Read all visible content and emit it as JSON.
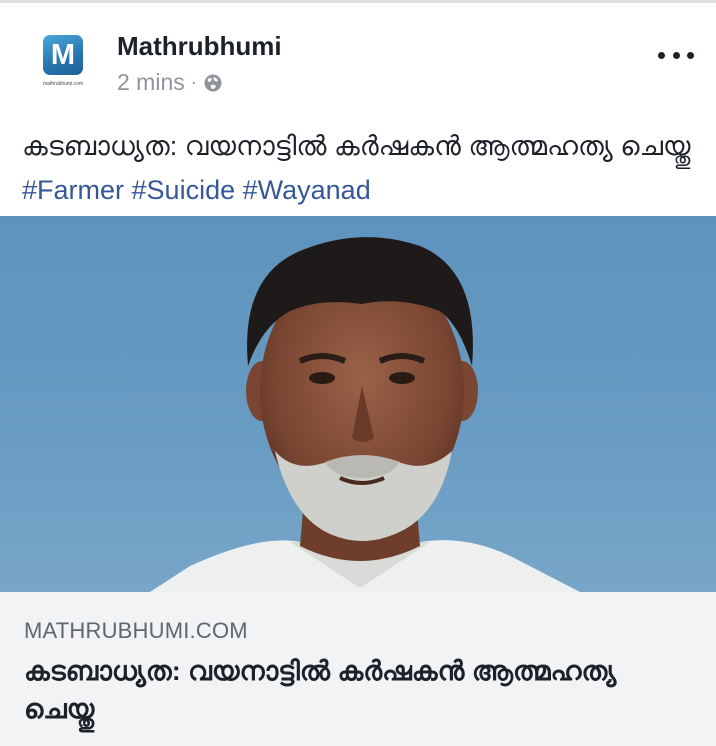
{
  "post": {
    "page_name": "Mathrubhumi",
    "avatar_letter": "M",
    "avatar_caption": "mathrubhumi.com",
    "timestamp": "2 mins",
    "separator": "·",
    "privacy_icon": "globe-icon",
    "more_icon": "more-horizontal-icon",
    "caption_text": "കടബാധ്യത: വയനാട്ടിൽ കർഷകൻ ആത്മഹത്യ ചെയ്തു",
    "hashtags": [
      "#Farmer",
      "#Suicide",
      "#Wayanad"
    ]
  },
  "link": {
    "domain": "MATHRUBHUMI.COM",
    "title": "കടബാധ്യത: വയനാട്ടിൽ കർഷകൻ ആത്മഹത്യ ചെയ്തു"
  },
  "colors": {
    "hashtag": "#365899",
    "image_background": "#6a9cc3",
    "preview_background": "#f2f3f5",
    "meta_text": "#90949c"
  }
}
